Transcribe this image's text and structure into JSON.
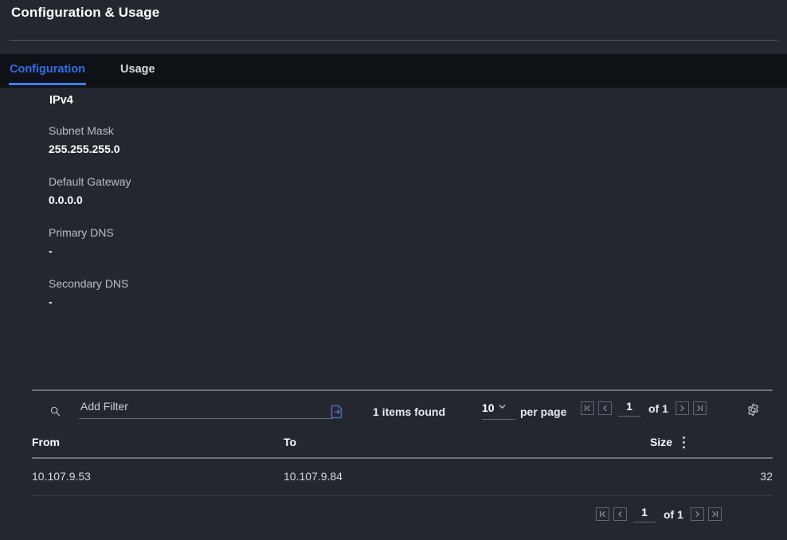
{
  "header": {
    "title": "Configuration & Usage"
  },
  "tabs": [
    {
      "label": "Configuration",
      "active": true
    },
    {
      "label": "Usage",
      "active": false
    }
  ],
  "details": {
    "section_heading": "IPv4",
    "fields": [
      {
        "label": "Subnet Mask",
        "value": "255.255.255.0"
      },
      {
        "label": "Default Gateway",
        "value": "0.0.0.0"
      },
      {
        "label": "Primary DNS",
        "value": "-"
      },
      {
        "label": "Secondary DNS",
        "value": "-"
      }
    ]
  },
  "toolbar": {
    "search_icon": "search-icon",
    "filter_placeholder": "Add Filter",
    "filter_value": "",
    "export_icon": "export-icon",
    "items_found": "1 items found",
    "per_page_value": "10",
    "per_page_label": "per page",
    "settings_icon": "gear-icon"
  },
  "pagination_top": {
    "first_label": "|<",
    "prev_label": "<",
    "page": "1",
    "of_label": "of 1",
    "next_label": ">",
    "last_label": ">|"
  },
  "pagination_bottom": {
    "first_label": "|<",
    "prev_label": "<",
    "page": "1",
    "of_label": "of 1",
    "next_label": ">",
    "last_label": ">|"
  },
  "table": {
    "columns": [
      {
        "label": "From"
      },
      {
        "label": "To"
      },
      {
        "label": "Size"
      }
    ],
    "rows": [
      {
        "from": "10.107.9.53",
        "to": "10.107.9.84",
        "size": "32"
      }
    ]
  },
  "colors": {
    "page_background": "#242730",
    "tabbar_background": "#0e1116",
    "accent_blue": "#3d7ff0",
    "text_primary": "#ffffff",
    "text_secondary": "#b9bfc9",
    "divider": "#6a7280"
  }
}
